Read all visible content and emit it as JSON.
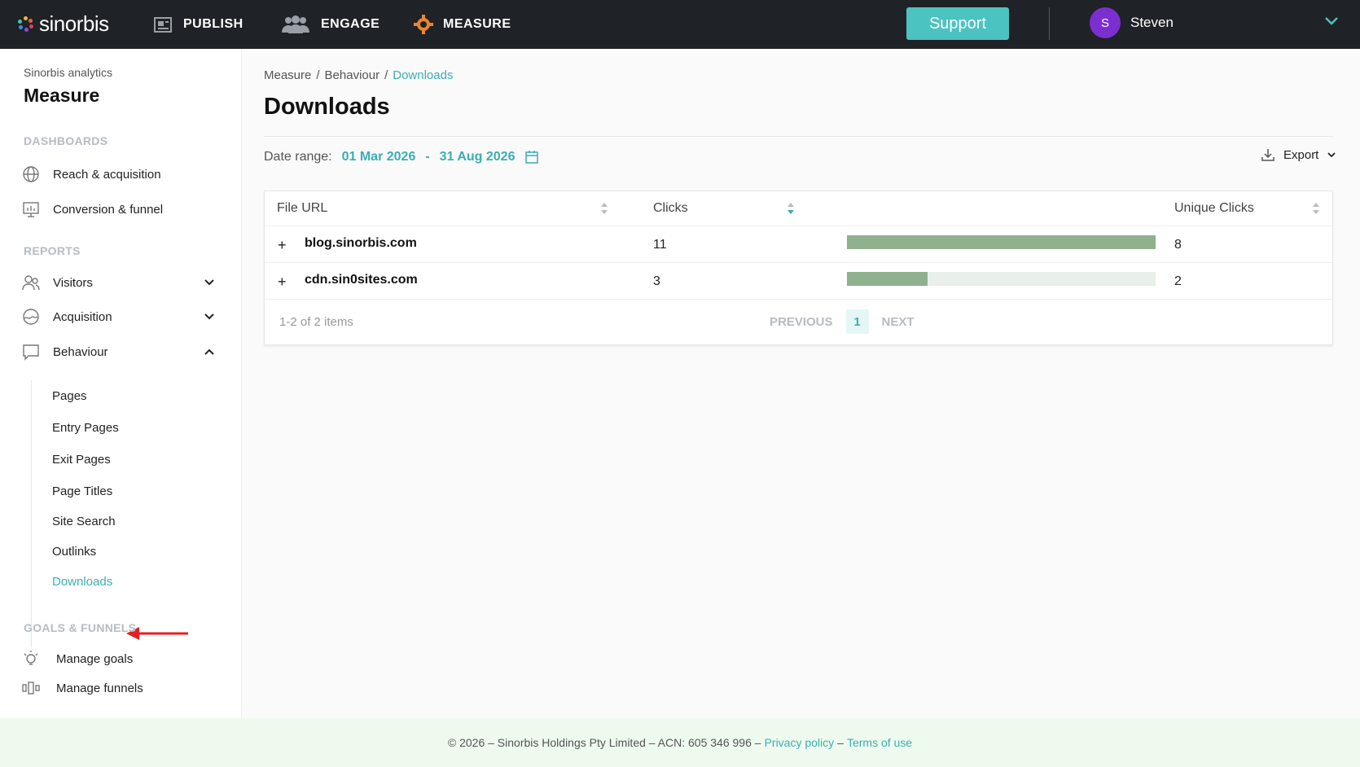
{
  "brand": {
    "name": "sinorbis",
    "accent": "#4bc3c0",
    "link": "#3aaeb3"
  },
  "topnav": {
    "items": [
      {
        "label": "PUBLISH",
        "icon": "publish-icon"
      },
      {
        "label": "ENGAGE",
        "icon": "engage-people-icon"
      },
      {
        "label": "MEASURE",
        "icon": "measure-gear-icon"
      }
    ],
    "support_label": "Support",
    "user": {
      "initial": "S",
      "name": "Steven",
      "avatar_color": "#7b2fd0"
    }
  },
  "sidebar": {
    "subtitle": "Sinorbis analytics",
    "title": "Measure",
    "sections": {
      "dashboards": "DASHBOARDS",
      "reports": "REPORTS",
      "goals": "GOALS & FUNNELS"
    },
    "dashboards": [
      {
        "label": "Reach & acquisition",
        "icon": "globe-icon"
      },
      {
        "label": "Conversion & funnel",
        "icon": "monitor-chart-icon"
      }
    ],
    "reports": [
      {
        "label": "Visitors",
        "icon": "visitors-icon",
        "expanded": false
      },
      {
        "label": "Acquisition",
        "icon": "acquisition-icon",
        "expanded": false
      },
      {
        "label": "Behaviour",
        "icon": "chat-bubble-icon",
        "expanded": true
      }
    ],
    "behaviour_items": [
      "Pages",
      "Entry Pages",
      "Exit Pages",
      "Page Titles",
      "Site Search",
      "Outlinks",
      "Downloads"
    ],
    "active_item": "Downloads",
    "goals": [
      {
        "label": "Manage goals",
        "icon": "lightbulb-icon"
      },
      {
        "label": "Manage funnels",
        "icon": "funnel-icon"
      }
    ]
  },
  "main": {
    "breadcrumb": [
      "Measure",
      "Behaviour",
      "Downloads"
    ],
    "title": "Downloads",
    "date_range": {
      "label": "Date range:",
      "start": "01 Mar 2026",
      "sep": "-",
      "end": "31 Aug 2026"
    },
    "export_label": "Export",
    "table": {
      "headers": {
        "file_url": "File URL",
        "clicks": "Clicks",
        "unique_clicks": "Unique Clicks"
      },
      "rows": [
        {
          "url": "blog.sinorbis.com",
          "clicks": "11",
          "unique": "8",
          "bar_fraction": 1.0
        },
        {
          "url": "cdn.sin0sites.com",
          "clicks": "3",
          "unique": "2",
          "bar_fraction": 0.26
        }
      ],
      "items_count": "1-2 of 2 items",
      "pager": {
        "prev": "PREVIOUS",
        "page": "1",
        "next": "NEXT"
      }
    }
  },
  "footer": {
    "text": "© 2026 – Sinorbis Holdings Pty Limited – ACN: 605 346 996 –",
    "privacy": "Privacy policy",
    "dash": "–",
    "terms": "Terms of use"
  }
}
